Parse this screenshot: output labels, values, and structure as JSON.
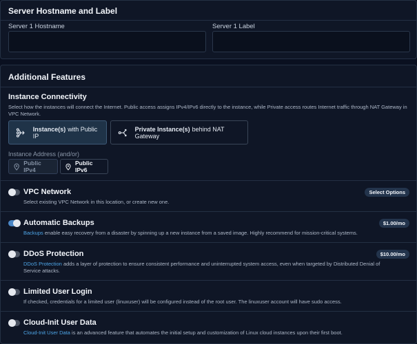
{
  "hostname_section": {
    "title": "Server Hostname and Label",
    "hostname_label": "Server 1 Hostname",
    "label_label": "Server 1 Label",
    "hostname_value": "",
    "label_value": ""
  },
  "features": {
    "title": "Additional Features",
    "connectivity": {
      "title": "Instance Connectivity",
      "description": "Select how the instances will connect the Internet. Public access assigns IPv4/IPv6 directly to the instance, while Private access routes Internet traffic through NAT Gateway in VPC Network.",
      "options": [
        {
          "bold": "Instance(s)",
          "rest": "with Public IP",
          "selected": true,
          "icon": "public-network-icon"
        },
        {
          "bold": "Private Instance(s)",
          "rest": "behind NAT Gateway",
          "selected": false,
          "icon": "nat-gateway-icon"
        }
      ],
      "address_label": "Instance Address (and/or)",
      "addresses": [
        {
          "label": "Public IPv4",
          "enabled": false,
          "icon": "location-pin-icon"
        },
        {
          "label": "Public IPv6",
          "enabled": true,
          "icon": "location-pin-icon"
        }
      ]
    },
    "items": [
      {
        "title": "VPC Network",
        "enabled": false,
        "desc_link": "",
        "desc": "Select existing VPC Network in this location, or create new one.",
        "badge": "Select Options"
      },
      {
        "title": "Automatic Backups",
        "enabled": true,
        "desc_link": "Backups",
        "desc": " enable easy recovery from a disaster by spinning up a new instance from a saved image. Highly recommend for mission-critical systems.",
        "badge": "$1.00/mo"
      },
      {
        "title": "DDoS Protection",
        "enabled": false,
        "desc_link": "DDoS Protection",
        "desc": " adds a layer of protection to ensure consistent performance and uninterrupted system access, even when targeted by Distributed Denial of Service attacks.",
        "badge": "$10.00/mo"
      },
      {
        "title": "Limited User Login",
        "enabled": false,
        "desc_link": "",
        "desc": "If checked, credentials for a limited user (linuxuser) will be configured instead of the root user. The linuxuser account will have sudo access.",
        "badge": ""
      },
      {
        "title": "Cloud-Init User Data",
        "enabled": false,
        "desc_link": "Cloud-Init User Data",
        "desc": " is an advanced feature that automates the initial setup and customization of Linux cloud instances upon their first boot.",
        "badge": ""
      }
    ]
  },
  "colors": {
    "background": "#0a1020",
    "panel": "#0f1626",
    "accent": "#4a86c5",
    "link": "#4ea6e8"
  }
}
